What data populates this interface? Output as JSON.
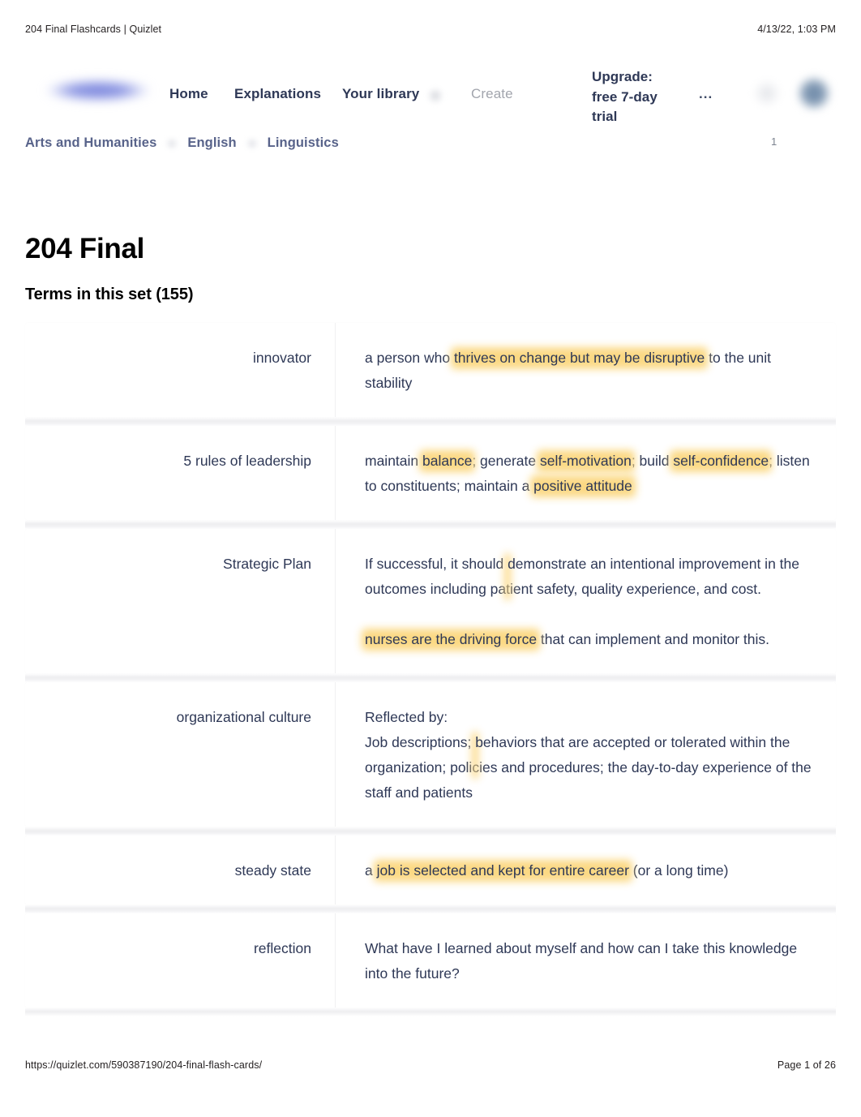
{
  "print": {
    "header_title": "204 Final Flashcards | Quizlet",
    "header_date": "4/13/22, 1:03 PM",
    "footer_url": "https://quizlet.com/590387190/204-final-flash-cards/",
    "footer_page": "Page 1 of 26"
  },
  "nav": {
    "logo_label": "Quizlet",
    "home": "Home",
    "explanations": "Explanations",
    "your_library": "Your library",
    "create": "Create",
    "upgrade": "Upgrade: free 7-day trial",
    "more": "...",
    "notification_count": "1"
  },
  "breadcrumb": {
    "items": [
      {
        "label": "Arts and Humanities"
      },
      {
        "label": "English"
      },
      {
        "label": "Linguistics"
      }
    ]
  },
  "page": {
    "title": "204 Final",
    "terms_heading": "Terms in this set (155)"
  },
  "colors": {
    "highlight": "#fbd77e",
    "text": "#2e3856",
    "breadcrumb": "#58638a",
    "logo": "#8e98e3",
    "muted": "#a2a5ad"
  },
  "terms": [
    {
      "term": "innovator",
      "paragraphs": [
        {
          "parts": [
            {
              "text": "a person who ",
              "highlight": false
            },
            {
              "text": "thrives on change but may be disruptive",
              "highlight": true
            },
            {
              "text": " to the unit stability",
              "highlight": false
            }
          ]
        }
      ]
    },
    {
      "term": "5 rules of leadership",
      "paragraphs": [
        {
          "parts": [
            {
              "text": "maintain ",
              "highlight": false
            },
            {
              "text": "balance",
              "highlight": true
            },
            {
              "text": "; generate ",
              "highlight": false
            },
            {
              "text": "self-motivation",
              "highlight": true
            },
            {
              "text": "; build ",
              "highlight": false
            },
            {
              "text": "self-confidence",
              "highlight": true
            },
            {
              "text": "; listen to constituents; maintain a ",
              "highlight": false
            },
            {
              "text": "positive attitude",
              "highlight": true
            }
          ]
        }
      ]
    },
    {
      "term": "Strategic Plan",
      "paragraphs": [
        {
          "parts": [
            {
              "text": "If successful, it should ",
              "highlight": false
            },
            {
              "text": "demonstrate an intentional improvement in the outcomes",
              "highlight": true
            },
            {
              "text": " including patient safety, quality experience, and cost.",
              "highlight": false
            }
          ]
        },
        {
          "spacer": true,
          "parts": [
            {
              "text": "nurses are the driving force",
              "highlight": true
            },
            {
              "text": " that can implement and monitor this.",
              "highlight": false
            }
          ]
        }
      ]
    },
    {
      "term": "organizational culture",
      "paragraphs": [
        {
          "parts": [
            {
              "text": "Reflected by:",
              "highlight": false
            }
          ]
        },
        {
          "parts": [
            {
              "text": "Job descriptions; ",
              "highlight": false
            },
            {
              "text": "behaviors that are accepted or tolerated within the organization",
              "highlight": true
            },
            {
              "text": "; policies and procedures; the day-to-day experience of the staff and patients",
              "highlight": false
            }
          ]
        }
      ]
    },
    {
      "term": "steady state",
      "paragraphs": [
        {
          "parts": [
            {
              "text": "a ",
              "highlight": false
            },
            {
              "text": "job is selected and kept for entire career",
              "highlight": true
            },
            {
              "text": " (or a long time)",
              "highlight": false
            }
          ]
        }
      ]
    },
    {
      "term": "reflection",
      "paragraphs": [
        {
          "parts": [
            {
              "text": "What have I learned about myself and how can I take this knowledge into the future?",
              "highlight": false
            }
          ]
        }
      ]
    }
  ]
}
